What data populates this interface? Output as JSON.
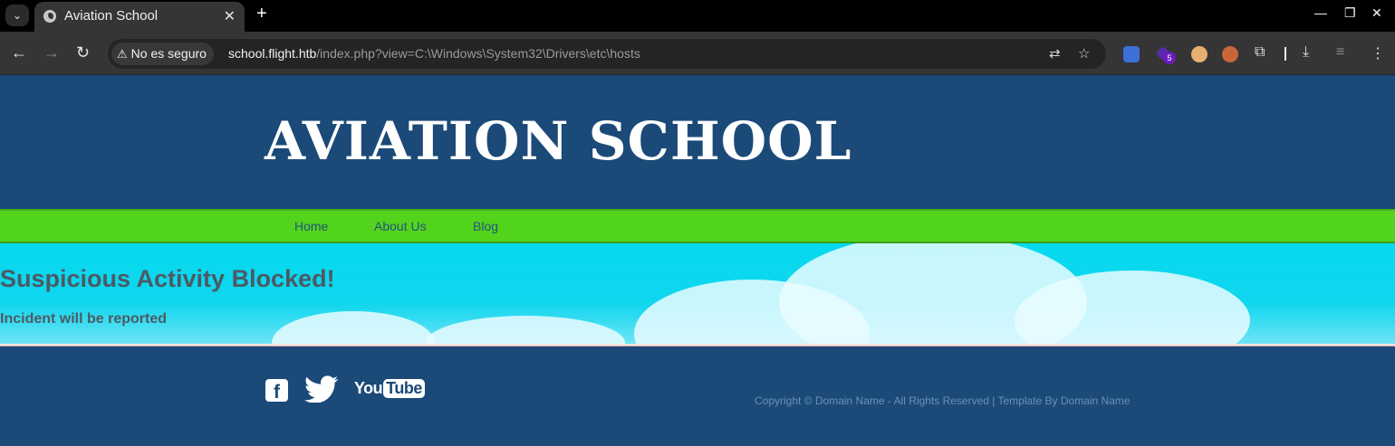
{
  "browser": {
    "tab_title": "Aviation School",
    "security_label": "No es seguro",
    "url_host": "school.flight.htb",
    "url_path": "/index.php?view=C:\\Windows\\System32\\Drivers\\etc\\hosts",
    "extension_badge": "5"
  },
  "site": {
    "title": "AVIATION SCHOOL",
    "nav": [
      "Home",
      "About Us",
      "Blog"
    ],
    "alert_heading": "Suspicious Activity Blocked!",
    "alert_message": "Incident will be reported",
    "social": [
      "facebook",
      "twitter",
      "youtube"
    ],
    "youtube_you": "You",
    "youtube_tube": "Tube",
    "copyright": "Copyright © Domain Name - All Rights Reserved | Template By Domain Name"
  },
  "colors": {
    "header_bg": "#1b4a78",
    "nav_bg": "#52d41c",
    "hero_bg": "#05d9f0",
    "alert_text": "#4c5a64"
  }
}
